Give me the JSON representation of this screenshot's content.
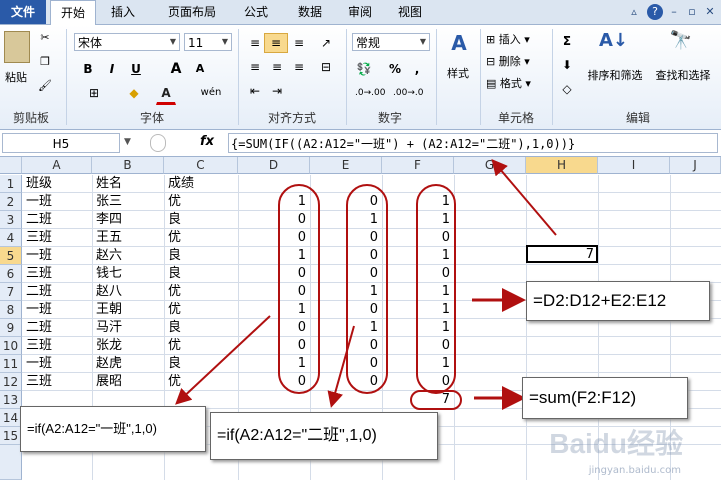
{
  "tabs": [
    "文件",
    "开始",
    "插入",
    "页面布局",
    "公式",
    "数据",
    "审阅",
    "视图"
  ],
  "ribbon": {
    "clipboard": {
      "title": "剪贴板",
      "paste": "粘贴"
    },
    "font": {
      "title": "字体",
      "name": "宋体",
      "size": "11",
      "bold": "B",
      "italic": "I",
      "underline": "U",
      "grow": "A",
      "shrink": "A",
      "wen": "wén",
      "a_color": "A"
    },
    "align": {
      "title": "对齐方式"
    },
    "number": {
      "title": "数字",
      "format": "常规",
      "percent": "%",
      "comma": ","
    },
    "styles": {
      "title": "",
      "label": "样式"
    },
    "cells": {
      "title": "单元格",
      "insert": "插入",
      "delete": "删除",
      "format": "格式"
    },
    "edit": {
      "title": "编辑",
      "sigma": "Σ",
      "sort": "排序和筛选",
      "find": "查找和选择"
    }
  },
  "formula_bar": {
    "name_box": "H5",
    "fx": "fx",
    "formula": "{=SUM(IF((A2:A12=\"一班\") + (A2:A12=\"二班\"),1,0))}"
  },
  "columns": [
    "A",
    "B",
    "C",
    "D",
    "E",
    "F",
    "G",
    "H",
    "I",
    "J"
  ],
  "rows": [
    "1",
    "2",
    "3",
    "4",
    "5",
    "6",
    "7",
    "8",
    "9",
    "10",
    "11",
    "12",
    "13",
    "14",
    "15"
  ],
  "header_row": [
    "班级",
    "姓名",
    "成绩"
  ],
  "data_rows": [
    [
      "一班",
      "张三",
      "优",
      "1",
      "0",
      "1"
    ],
    [
      "二班",
      "李四",
      "良",
      "0",
      "1",
      "1"
    ],
    [
      "三班",
      "王五",
      "优",
      "0",
      "0",
      "0"
    ],
    [
      "一班",
      "赵六",
      "良",
      "1",
      "0",
      "1"
    ],
    [
      "三班",
      "钱七",
      "良",
      "0",
      "0",
      "0"
    ],
    [
      "二班",
      "赵八",
      "优",
      "0",
      "1",
      "1"
    ],
    [
      "一班",
      "王朝",
      "优",
      "1",
      "0",
      "1"
    ],
    [
      "二班",
      "马汗",
      "良",
      "0",
      "1",
      "1"
    ],
    [
      "三班",
      "张龙",
      "优",
      "0",
      "0",
      "0"
    ],
    [
      "一班",
      "赵虎",
      "良",
      "1",
      "0",
      "1"
    ],
    [
      "三班",
      "展昭",
      "优",
      "0",
      "0",
      "0"
    ]
  ],
  "f13_value": "7",
  "h5_value": "7",
  "callouts": {
    "d_formula": "=D2:D12+E2:E12",
    "sum_formula": "=sum(F2:F12)",
    "if_one": "=if(A2:A12=\"一班\",1,0)",
    "if_two": "=if(A2:A12=\"二班\",1,0)"
  },
  "watermark": "Baidu经验",
  "watermark_url": "jingyan.baidu.com",
  "colors": {
    "annotation": "#b01010",
    "selected_header": "#f8d98e",
    "file_tab": "#2a5aa8"
  }
}
